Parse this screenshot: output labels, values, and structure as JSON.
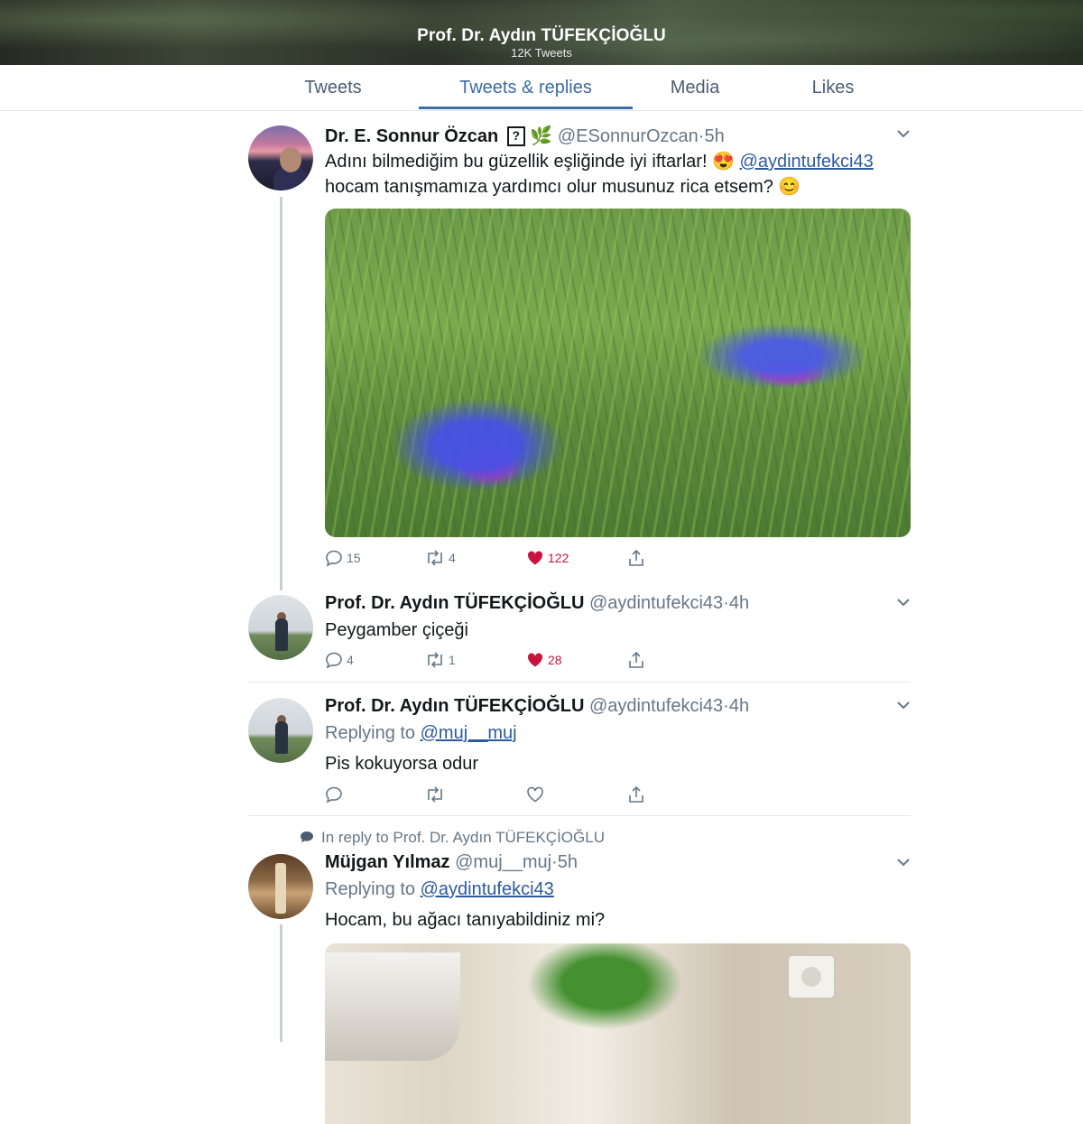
{
  "header": {
    "title": "Prof. Dr. Aydın TÜFEKÇİOĞLU",
    "subtitle": "12K Tweets"
  },
  "tabs": [
    {
      "label": "Tweets",
      "active": false
    },
    {
      "label": "Tweets & replies",
      "active": true
    },
    {
      "label": "Media",
      "active": false
    },
    {
      "label": "Likes",
      "active": false
    }
  ],
  "colors": {
    "accent": "#3a6ca5",
    "like": "#c8143c",
    "muted": "#657786",
    "link": "#2b5a9e"
  },
  "tweets": [
    {
      "name": "Dr. E. Sonnur Özcan",
      "badge": "?",
      "emoji": "🌿",
      "handle": "@ESonnurOzcan",
      "time": "5h",
      "text_line1": "Adını bilmediğim bu güzellik eşliğinde iyi iftarlar! 😍",
      "mention": "@aydintufekci43",
      "text_line2": "hocam tanışmamıza yardımcı olur musunuz rica etsem? 😊",
      "replies": "15",
      "retweets": "4",
      "likes": "122",
      "liked": true,
      "media": "photo of blue cornflowers in grass"
    },
    {
      "name": "Prof. Dr. Aydın TÜFEKÇİOĞLU",
      "handle": "@aydintufekci43",
      "time": "4h",
      "text": "Peygamber çiçeği",
      "replies": "4",
      "retweets": "1",
      "likes": "28",
      "liked": true
    },
    {
      "name": "Prof. Dr. Aydın TÜFEKÇİOĞLU",
      "handle": "@aydintufekci43",
      "time": "4h",
      "replying_label": "Replying to",
      "replying_to": "@muj__muj",
      "text": "Pis kokuyorsa odur",
      "replies": "",
      "retweets": "",
      "likes": "",
      "liked": false
    },
    {
      "in_reply_context": "In reply to Prof. Dr. Aydın TÜFEKÇİOĞLU",
      "name": "Müjgan Yılmaz",
      "handle": "@muj__muj",
      "time": "5h",
      "replying_label": "Replying to",
      "replying_to": "@aydintufekci43",
      "text": "Hocam, bu ağacı tanıyabildiniz mi?",
      "media": "photo of a young tree seedling near a wall socket"
    }
  ],
  "icons": [
    "reply-icon",
    "retweet-icon",
    "heart-icon",
    "share-icon",
    "chevron-down-icon",
    "speech-bubble-icon"
  ]
}
